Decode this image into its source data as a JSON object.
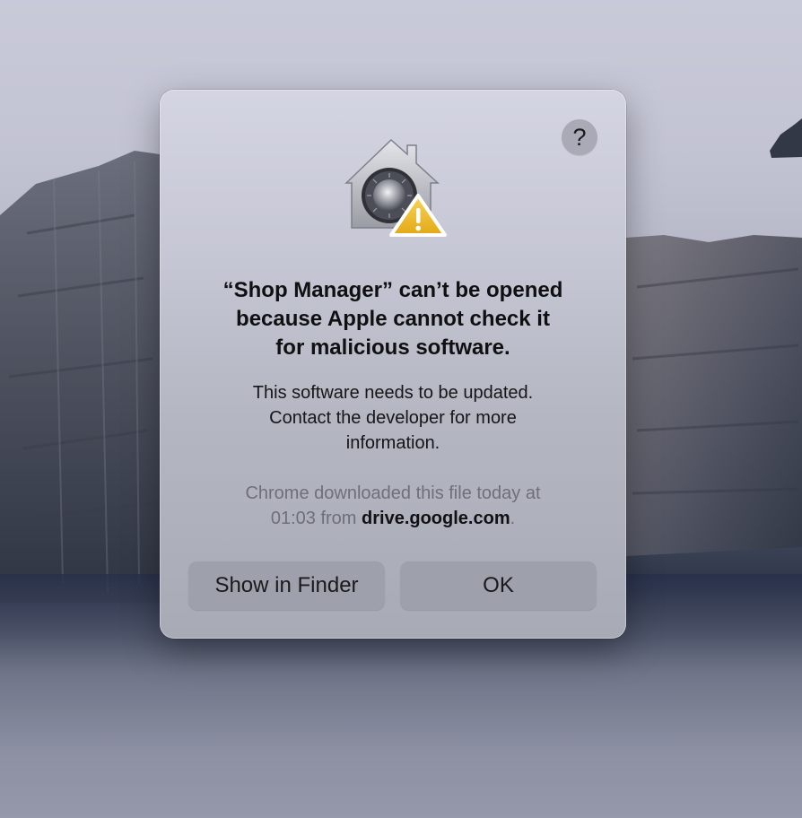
{
  "dialog": {
    "help_label": "?",
    "icon": "gatekeeper-safe-house-warning-icon",
    "title_line1": "“Shop Manager” can’t be opened",
    "title_line2": "because Apple cannot check it",
    "title_line3": "for malicious software.",
    "message_line1": "This software needs to be updated.",
    "message_line2": "Contact the developer for more",
    "message_line3": "information.",
    "source_line1": "Chrome downloaded this file today at",
    "source_time": "01:03",
    "source_from": "from",
    "source_domain": "drive.google.com",
    "source_period": ".",
    "buttons": {
      "show_in_finder": "Show in Finder",
      "ok": "OK"
    }
  },
  "colors": {
    "warning_yellow": "#f2c12e",
    "dialog_bg": "#c6c7d4",
    "button_bg": "#9ea0ab"
  }
}
